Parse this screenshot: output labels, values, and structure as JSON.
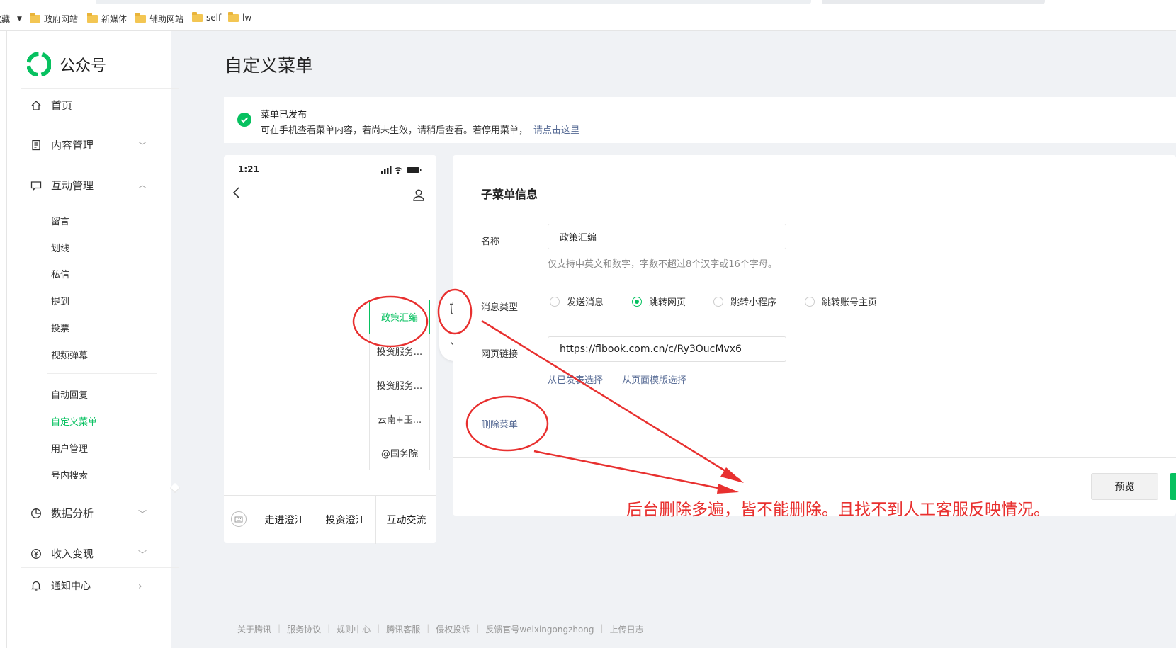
{
  "bookmarks": {
    "partial": "收藏",
    "items": [
      "政府网站",
      "新媒体",
      "辅助网站",
      "self",
      "lw"
    ]
  },
  "sidebar": {
    "logo_text": "公众号",
    "home": "首页",
    "content": "内容管理",
    "interaction": "互动管理",
    "interaction_items": [
      "留言",
      "划线",
      "私信",
      "提到",
      "投票",
      "视频弹幕"
    ],
    "interaction_items2": [
      "自动回复",
      "自定义菜单",
      "用户管理",
      "号内搜索"
    ],
    "analytics": "数据分析",
    "monetize": "收入变现",
    "notifications": "通知中心",
    "accent_color": "#07c160"
  },
  "page": {
    "title": "自定义菜单",
    "notice_title": "菜单已发布",
    "notice_text": "可在手机查看菜单内容，若尚未生效，请稍后查看。若停用菜单，",
    "notice_link": "请点击这里"
  },
  "phone": {
    "time": "1:21",
    "submenus": [
      "政策汇编",
      "投资服务...",
      "投资服务...",
      "云南+玉...",
      "@国务院"
    ],
    "menu_tabs": [
      "走进澄江",
      "投资澄江",
      "互动交流"
    ]
  },
  "form": {
    "section_title": "子菜单信息",
    "name_label": "名称",
    "name_value": "政策汇编",
    "name_hint": "仅支持中英文和数字，字数不超过8个汉字或16个字母。",
    "type_label": "消息类型",
    "types": [
      "发送消息",
      "跳转网页",
      "跳转小程序",
      "跳转账号主页"
    ],
    "selected_type": "跳转网页",
    "url_label": "网页链接",
    "url_value": "https://flbook.com.cn/c/Ry3OucMvx6",
    "pick_published": "从已发表选择",
    "pick_template": "从页面模版选择",
    "delete_menu": "删除菜单",
    "preview_button": "预览"
  },
  "footer": [
    "关于腾讯",
    "服务协议",
    "规则中心",
    "腾讯客服",
    "侵权投诉",
    "反馈官号weixingongzhong",
    "上传日志"
  ],
  "annotation": {
    "text": "后台删除多遍，皆不能删除。且找不到人工客服反映情况。",
    "color": "#e8302f"
  }
}
